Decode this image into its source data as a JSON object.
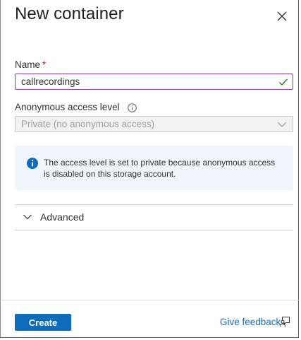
{
  "panel": {
    "title": "New container"
  },
  "name_field": {
    "label": "Name",
    "required_marker": "*",
    "value": "callrecordings",
    "status_icon": "checkmark-icon",
    "status_color": "#107c10"
  },
  "access_level": {
    "label": "Anonymous access level",
    "selected_value": "Private (no anonymous access)",
    "disabled": true
  },
  "info_message": {
    "text": "The access level is set to private because anonymous access is disabled on this storage account.",
    "icon": "info-icon",
    "icon_color": "#0f6cbd"
  },
  "advanced": {
    "label": "Advanced",
    "expanded": false
  },
  "footer": {
    "create_label": "Create",
    "feedback_label": "Give feedback",
    "feedback_icon": "feedback-icon"
  },
  "colors": {
    "accent": "#0f6cbd",
    "input_focus_border": "#8a3a9a",
    "info_background": "#eff6fc",
    "required": "#a4262c"
  }
}
